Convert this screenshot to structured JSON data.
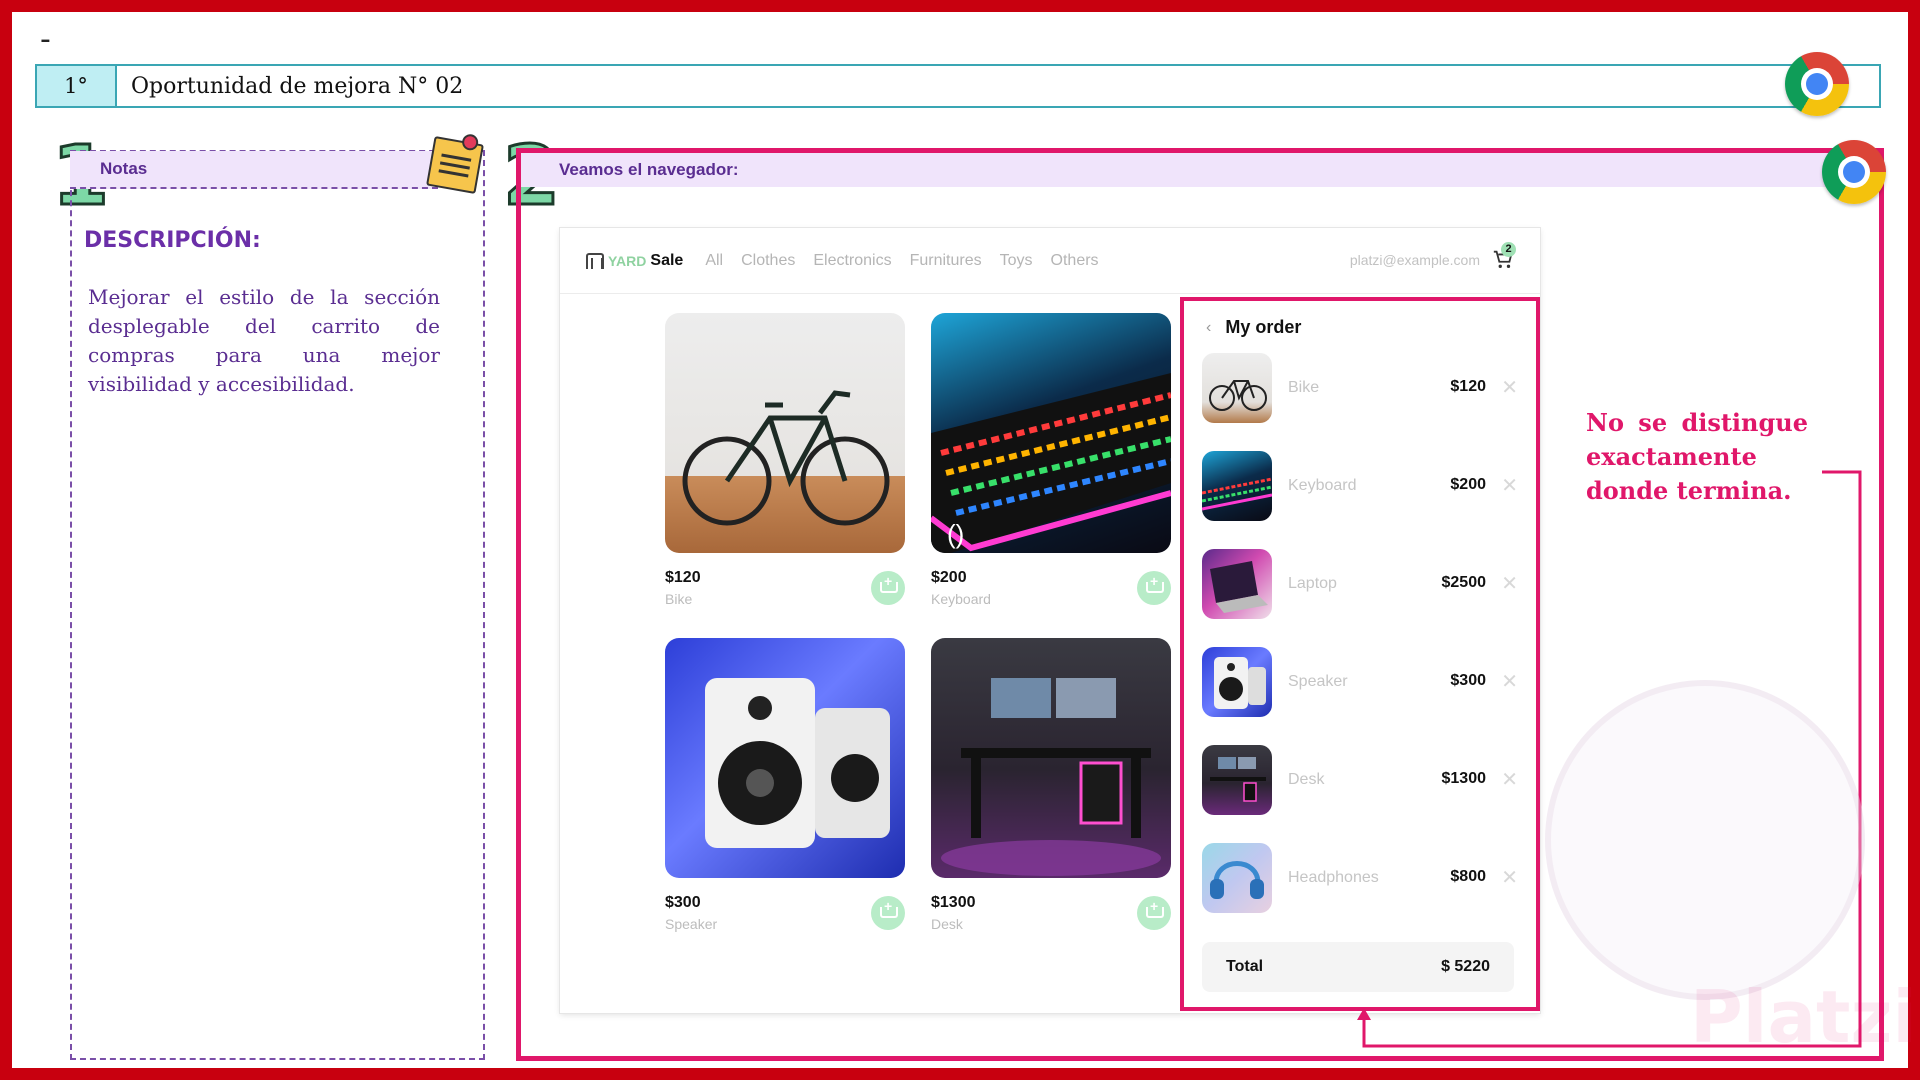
{
  "slide": {
    "dash": "-",
    "index": "1°",
    "title": "Oportunidad de mejora N° 02"
  },
  "notes": {
    "number": "1",
    "header": "Notas",
    "desc_title": "DESCRIPCIÓN:",
    "desc_text": "Mejorar el estilo de la sección desplegable del carrito de compras para una mejor visibilidad y accesibilidad."
  },
  "browser": {
    "number": "2",
    "header": "Veamos el navegador:"
  },
  "app": {
    "logo_yard": "YARD",
    "logo_sale": "Sale",
    "nav": [
      "All",
      "Clothes",
      "Electronics",
      "Furnitures",
      "Toys",
      "Others"
    ],
    "user_email": "platzi@example.com",
    "cart_count": "2",
    "products": [
      {
        "price": "$120",
        "name": "Bike",
        "image": "bike"
      },
      {
        "price": "$200",
        "name": "Keyboard",
        "image": "keyboard"
      },
      {
        "price": "$300",
        "name": "Speaker",
        "image": "speaker"
      },
      {
        "price": "$1300",
        "name": "Desk",
        "image": "desk"
      }
    ],
    "keyboard_overlay": "()"
  },
  "order": {
    "title": "My order",
    "items": [
      {
        "name": "Bike",
        "price": "$120"
      },
      {
        "name": "Keyboard",
        "price": "$200"
      },
      {
        "name": "Laptop",
        "price": "$2500"
      },
      {
        "name": "Speaker",
        "price": "$300"
      },
      {
        "name": "Desk",
        "price": "$1300"
      },
      {
        "name": "Headphones",
        "price": "$800"
      }
    ],
    "total_label": "Total",
    "total_value": "$ 5220",
    "remove_glyph": "✕"
  },
  "annotation": {
    "text": "No se distingue exactamente donde termina."
  },
  "colors": {
    "frame": "#c8000f",
    "accent_pink": "#e0176a",
    "header_teal": "#3aa6b4",
    "purple_text": "#5a2d91",
    "lavender": "#f0e4fb"
  }
}
